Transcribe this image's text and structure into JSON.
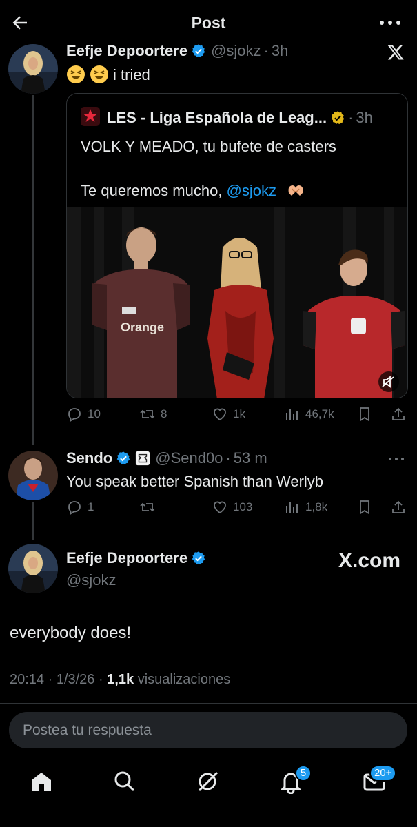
{
  "header": {
    "title": "Post",
    "back_icon": "arrow-left-icon",
    "more_icon": "more-horizontal-icon"
  },
  "colors": {
    "background": "#000000",
    "text": "#e7e9ea",
    "muted": "#71767b",
    "link": "#1d9bf0",
    "verified_blue": "#1d9bf0",
    "verified_gold": "#e2b719",
    "badge": "#1d9bf0"
  },
  "parent_post": {
    "name": "Eefje Depoortere",
    "handle": "@sjokz",
    "time": "3h",
    "text": "i tried",
    "quote": {
      "name": "LES - Liga Española de Leag...",
      "time": "3h",
      "line1": "VOLK Y MEADO, tu bufete de casters",
      "line2_prefix": "Te queremos mucho, ",
      "line2_mention": "@sjokz",
      "media_jersey_text": "Orange"
    },
    "actions": {
      "replies": "10",
      "reposts": "8",
      "likes": "1k",
      "views": "46,7k"
    }
  },
  "reply_post": {
    "name": "Sendo",
    "handle": "@Send0o",
    "time": "53 m",
    "text": "You speak better Spanish than Werlyb",
    "actions": {
      "replies": "1",
      "reposts": "",
      "likes": "103",
      "views": "1,8k"
    }
  },
  "main_post": {
    "name": "Eefje Depoortere",
    "handle": "@sjokz",
    "watermark": "X.com",
    "text": "everybody does!",
    "timestamp": "20:14 · 1/3/26 · ",
    "views_count": "1,1k",
    "views_label": " visualizaciones"
  },
  "reply_input": {
    "placeholder": "Postea tu respuesta"
  },
  "bottom_nav": {
    "items": [
      "home-icon",
      "search-icon",
      "grok-icon",
      "notifications-icon",
      "messages-icon"
    ],
    "notifications_badge": "5",
    "messages_badge": "20+"
  }
}
